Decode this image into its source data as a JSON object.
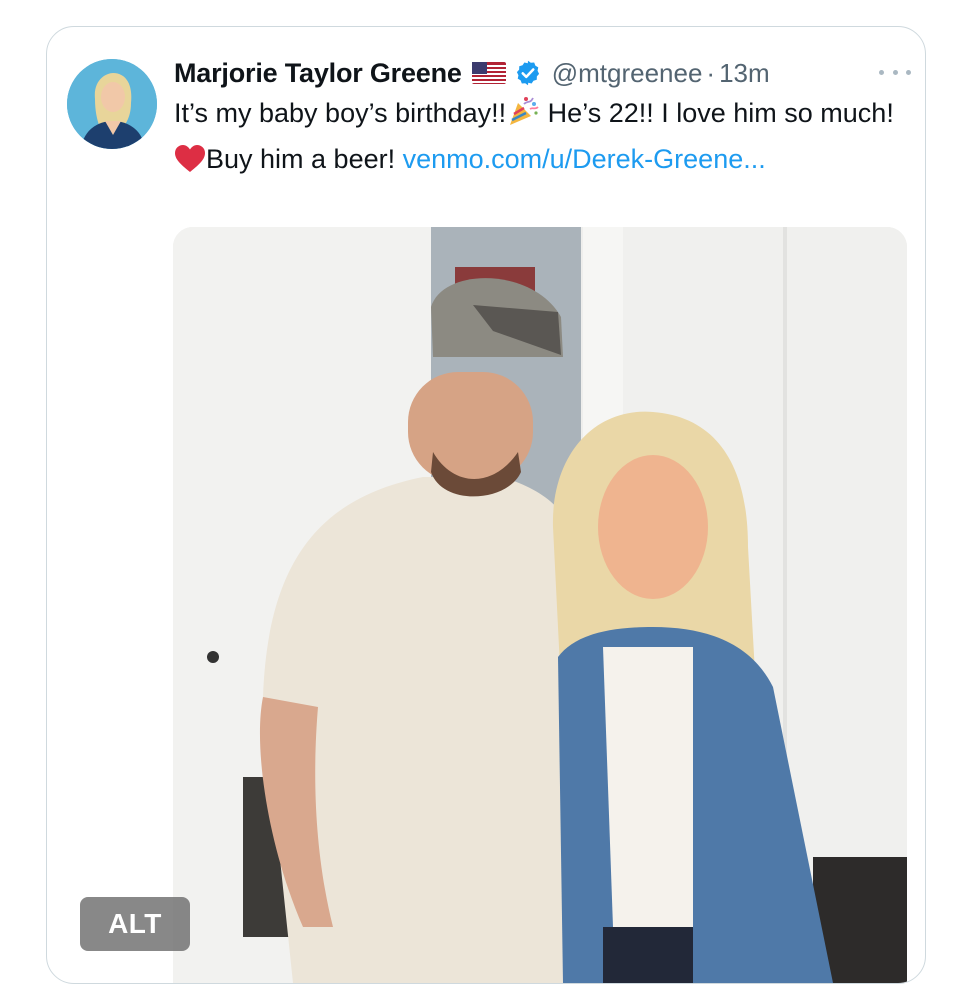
{
  "tweet": {
    "author": {
      "display_name": "Marjorie Taylor Greene",
      "handle": "@mtgreenee",
      "separator": "·",
      "time": "13m",
      "flag_icon": "us-flag-icon",
      "verified_icon": "verified-badge-icon",
      "avatar_icon": "profile-avatar"
    },
    "text": {
      "line1_part1": "It’s my baby boy’s birthday!!",
      "party_emoji": "party-popper-icon",
      "line1_part2": " He’s 22!! I love him so much! ",
      "heart_emoji": "red-heart-icon",
      "line2_part": "Buy him a beer! ",
      "link": "venmo.com/u/Derek-Greene..."
    },
    "media": {
      "alt_badge": "ALT",
      "image_subject": "photo-two-people"
    },
    "more_icon": "more-options-icon"
  },
  "colors": {
    "text": "#0f1419",
    "secondary": "#536471",
    "link": "#1d9bf0",
    "border": "#cfd9de",
    "verified": "#1d9bf0"
  }
}
